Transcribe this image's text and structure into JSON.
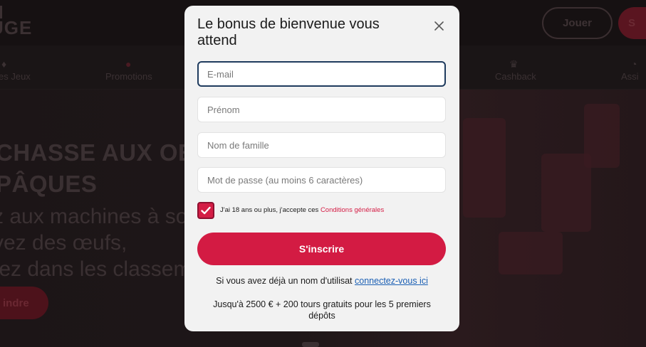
{
  "background": {
    "logo_line1": "N",
    "logo_line2": "UGE",
    "play_button": "Jouer",
    "signup_pill": "S",
    "nav": {
      "games": "es Jeux",
      "promotions": "Promotions",
      "cashback": "Cashback",
      "support": "Assi"
    },
    "hero": {
      "title_line1": "CHASSE AUX OEU",
      "title_line2": "PÂQUES",
      "text_line1": "z aux machines à so",
      "text_line2": "vez des œufs,",
      "text_line3": "tez dans les classem",
      "cta": "indre"
    }
  },
  "modal": {
    "title": "Le bonus de bienvenue vous attend",
    "fields": {
      "email_placeholder": "E-mail",
      "firstname_placeholder": "Prénom",
      "lastname_placeholder": "Nom de famille",
      "password_placeholder": "Mot de passe (au moins 6 caractères)"
    },
    "terms_text": "J'ai 18 ans ou plus, j'accepte ces",
    "terms_link": "Conditions générales",
    "submit_label": "S'inscrire",
    "login_prefix": "Si vous avez déjà un nom d'utilisat",
    "login_link": "connectez-vous ici",
    "bonus_text": "Jusqu'à 2500 € + 200 tours gratuits pour les 5 premiers dépôts"
  },
  "colors": {
    "accent": "#d31b43",
    "link": "#1a5fb4",
    "focus_border": "#1f3b5e",
    "modal_bg": "#f2f2f2"
  },
  "icons": {
    "close": "close-icon",
    "check": "checkmark-icon"
  }
}
